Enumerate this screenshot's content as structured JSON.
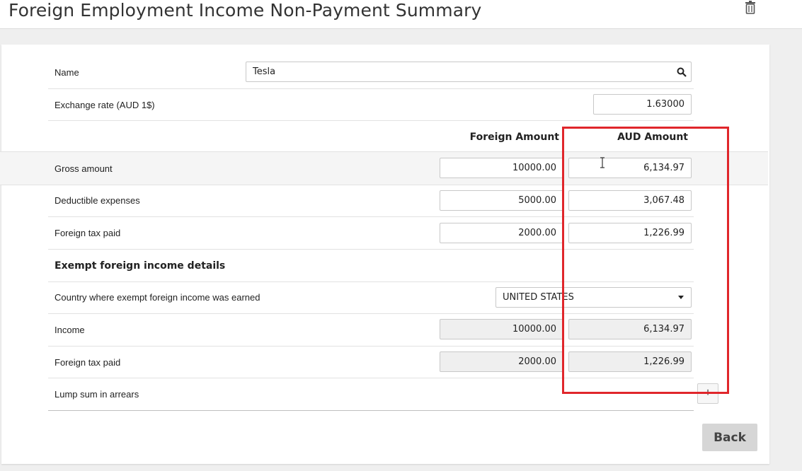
{
  "header": {
    "title": "Foreign Employment Income Non-Payment Summary",
    "delete_icon": "trash-icon"
  },
  "form": {
    "name": {
      "label": "Name",
      "value": "Tesla",
      "icon": "search-icon"
    },
    "exchange_rate": {
      "label": "Exchange rate (AUD 1$)",
      "value": "1.63000"
    },
    "columns": {
      "foreign": "Foreign Amount",
      "aud": "AUD Amount"
    },
    "rows": [
      {
        "label": "Gross amount",
        "foreign": "10000.00",
        "aud": "6,134.97"
      },
      {
        "label": "Deductible expenses",
        "foreign": "5000.00",
        "aud": "3,067.48"
      },
      {
        "label": "Foreign tax paid",
        "foreign": "2000.00",
        "aud": "1,226.99"
      }
    ],
    "exempt": {
      "heading": "Exempt foreign income details",
      "country": {
        "label": "Country where exempt foreign income was earned",
        "value": "UNITED STATES"
      },
      "income": {
        "label": "Income",
        "foreign": "10000.00",
        "aud": "6,134.97"
      },
      "tax": {
        "label": "Foreign tax paid",
        "foreign": "2000.00",
        "aud": "1,226.99"
      }
    },
    "lump_sum": {
      "label": "Lump sum in arrears",
      "button": "+"
    }
  },
  "footer": {
    "back_label": "Back"
  },
  "colors": {
    "highlight": "#e0262b",
    "back_button": "#d6d6d6"
  }
}
